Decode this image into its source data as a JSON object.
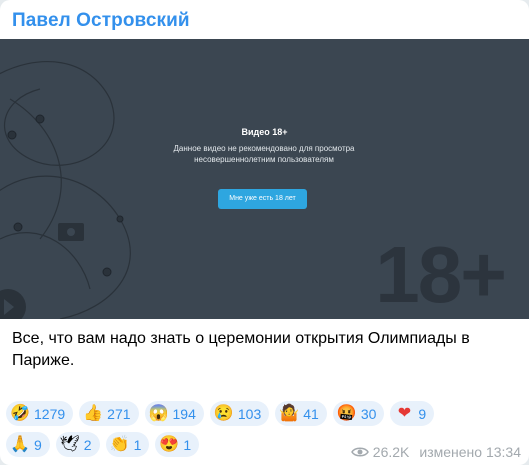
{
  "sender": "Павел Островский",
  "media": {
    "title": "Видео 18+",
    "warning": "Данное видео не рекомендовано для просмотра несовершеннолетним пользователям",
    "button_label": "Мне уже есть 18 лет",
    "badge": "18+"
  },
  "caption": "Все, что вам надо знать о церемонии открытия Олимпиады в Париже.",
  "reactions_row1": [
    {
      "emoji": "🤣",
      "count": "1279"
    },
    {
      "emoji": "👍",
      "count": "271"
    },
    {
      "emoji": "😱",
      "count": "194"
    },
    {
      "emoji": "😢",
      "count": "103"
    },
    {
      "emoji": "🤷",
      "count": "41"
    },
    {
      "emoji": "🤬",
      "count": "30"
    },
    {
      "emoji": "❤",
      "count": "9"
    }
  ],
  "reactions_row2": [
    {
      "emoji": "🙏",
      "count": "9"
    },
    {
      "emoji": "🕊",
      "count": "2"
    },
    {
      "emoji": "👏",
      "count": "1"
    },
    {
      "emoji": "😍",
      "count": "1"
    }
  ],
  "meta": {
    "views": "26.2K",
    "edited_time": "изменено 13:34"
  },
  "colors": {
    "accent": "#3390ec",
    "media_bg": "#3b4651",
    "button": "#2ea6e0"
  }
}
